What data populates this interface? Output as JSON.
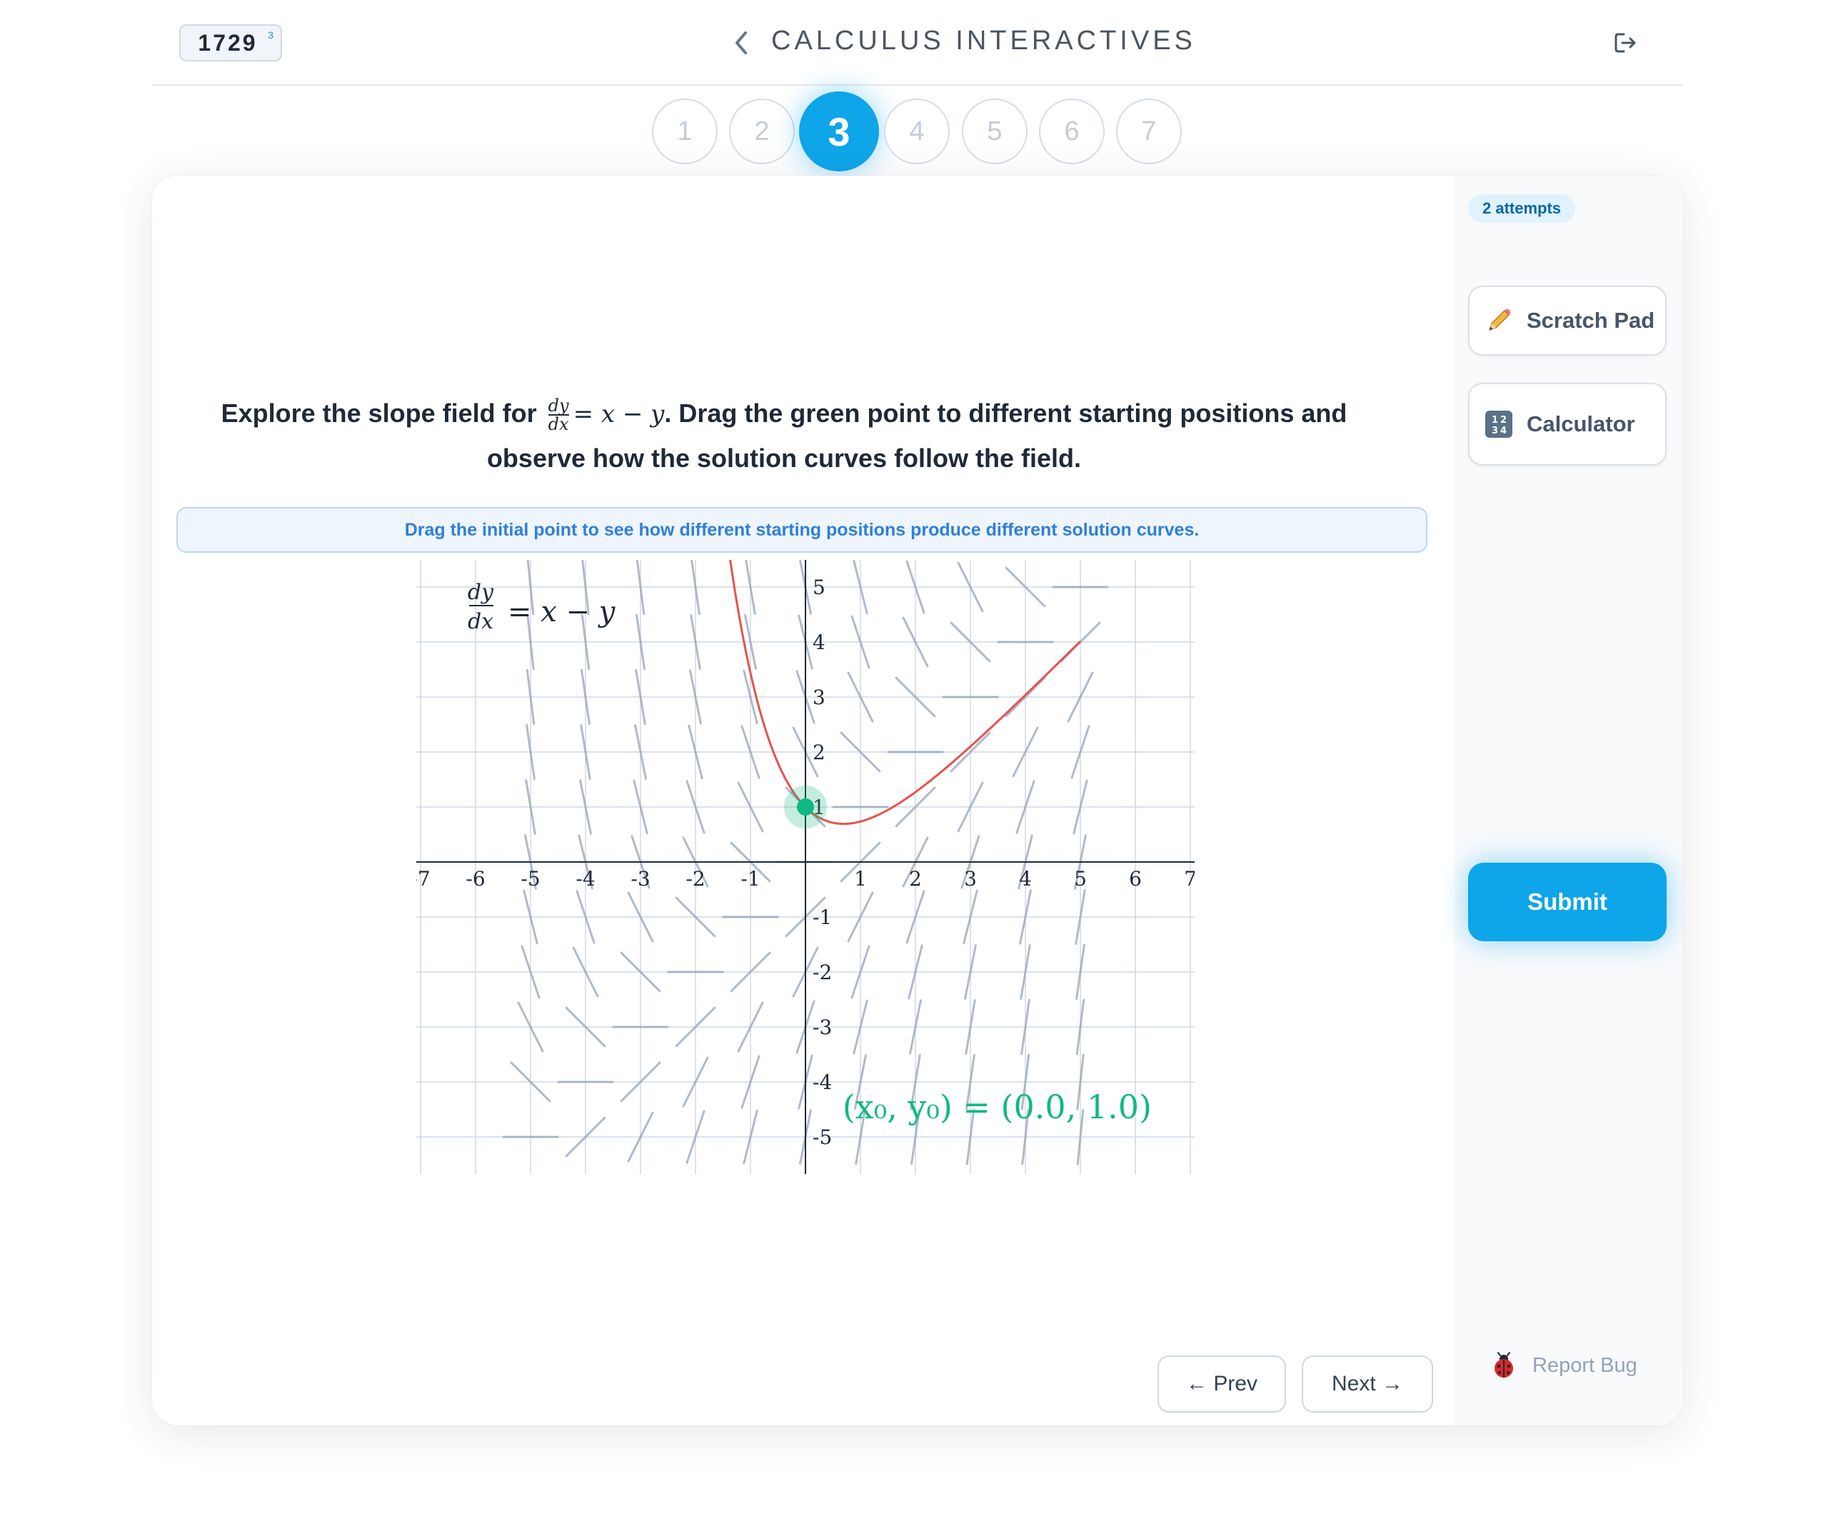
{
  "header": {
    "counter": "1729",
    "counter_sup": "3",
    "title": "CALCULUS INTERACTIVES"
  },
  "steps": [
    "1",
    "2",
    "3",
    "4",
    "5",
    "6",
    "7"
  ],
  "active_step": 3,
  "sidebar": {
    "attempts": "2 attempts",
    "scratch_pad": "Scratch Pad",
    "calculator": "Calculator",
    "submit": "Submit",
    "report_bug": "Report Bug"
  },
  "question": {
    "before": "Explore the slope field for ",
    "frac_num": "dy",
    "frac_den": "dx",
    "rhs": "= x − y",
    "after": ". Drag the green point to different starting positions and observe how the solution curves follow the field."
  },
  "hint": "Drag the initial point to see how different starting positions produce different solution curves.",
  "nav": {
    "prev": "← Prev",
    "next": "Next →"
  },
  "plot": {
    "equation_rhs": "= x − y",
    "initial_point_label": "(x₀, y₀) = (0.0,  1.0)",
    "x_ticks": [
      "-7",
      "-6",
      "-5",
      "-4",
      "-3",
      "-2",
      "-1",
      "1",
      "2",
      "3",
      "4",
      "5",
      "6",
      "7"
    ],
    "y_ticks": [
      "5",
      "4",
      "3",
      "2",
      "1",
      "-1",
      "-2",
      "-3",
      "-4",
      "-5"
    ],
    "xlim": [
      -7,
      7
    ],
    "ylim": [
      -5.5,
      5.5
    ],
    "initial_point": {
      "x": 0.0,
      "y": 1.0
    },
    "colors": {
      "curve": "#e5534b",
      "point": "#10b981",
      "field": "#94a3b8",
      "grid": "#d1d9e6"
    }
  }
}
